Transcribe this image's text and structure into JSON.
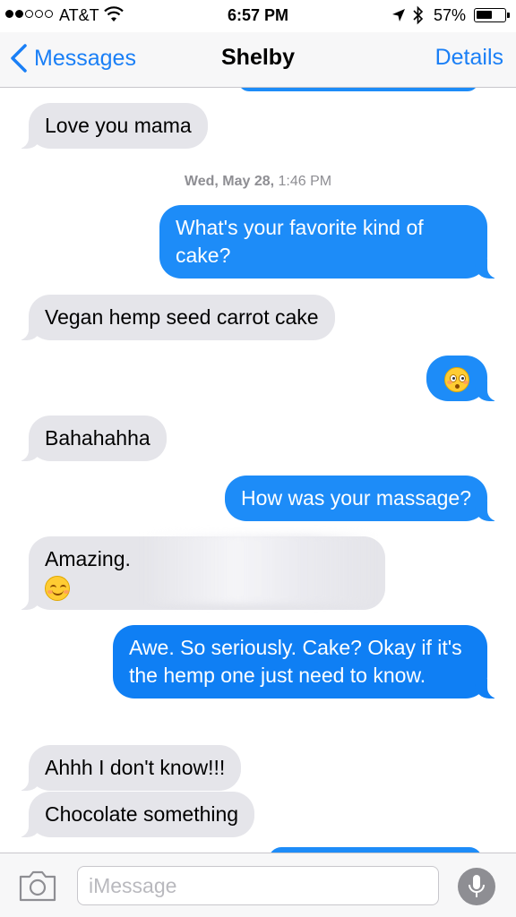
{
  "status_bar": {
    "carrier": "AT&T",
    "time": "6:57 PM",
    "battery_percent": "57%",
    "battery_level": 0.57,
    "signal_bars_filled": 2,
    "signal_bars_total": 5,
    "icons": [
      "wifi-icon",
      "location-arrow-icon",
      "bluetooth-icon",
      "battery-icon"
    ]
  },
  "nav": {
    "back_label": "Messages",
    "title": "Shelby",
    "details_label": "Details"
  },
  "conversation": {
    "timestamp_date": "Wed, May 28,",
    "timestamp_time": "1:46 PM",
    "messages": [
      {
        "from": "them",
        "text": "Love you mama"
      },
      {
        "from": "me",
        "text": "What's your favorite kind of cake?"
      },
      {
        "from": "them",
        "text": "Vegan hemp seed carrot cake"
      },
      {
        "from": "me",
        "text": "",
        "emoji": "flushed-face"
      },
      {
        "from": "them",
        "text": "Bahahahha"
      },
      {
        "from": "me",
        "text": "How was your massage?"
      },
      {
        "from": "them",
        "text": "Amazing.",
        "emoji": "smiling-face"
      },
      {
        "from": "me",
        "text": "Awe.  So seriously. Cake?  Okay if it's the hemp one just need to know."
      },
      {
        "from": "them",
        "text": "Ahhh I don't know!!!"
      },
      {
        "from": "them",
        "text": "Chocolate something"
      }
    ]
  },
  "input_bar": {
    "placeholder": "iMessage",
    "icons": [
      "camera-icon",
      "microphone-icon"
    ]
  },
  "colors": {
    "accent": "#1a7ff6",
    "outgoing_bubble": "#1d8cf8",
    "incoming_bubble": "#e5e5ea",
    "timestamp": "#8e8e93"
  }
}
